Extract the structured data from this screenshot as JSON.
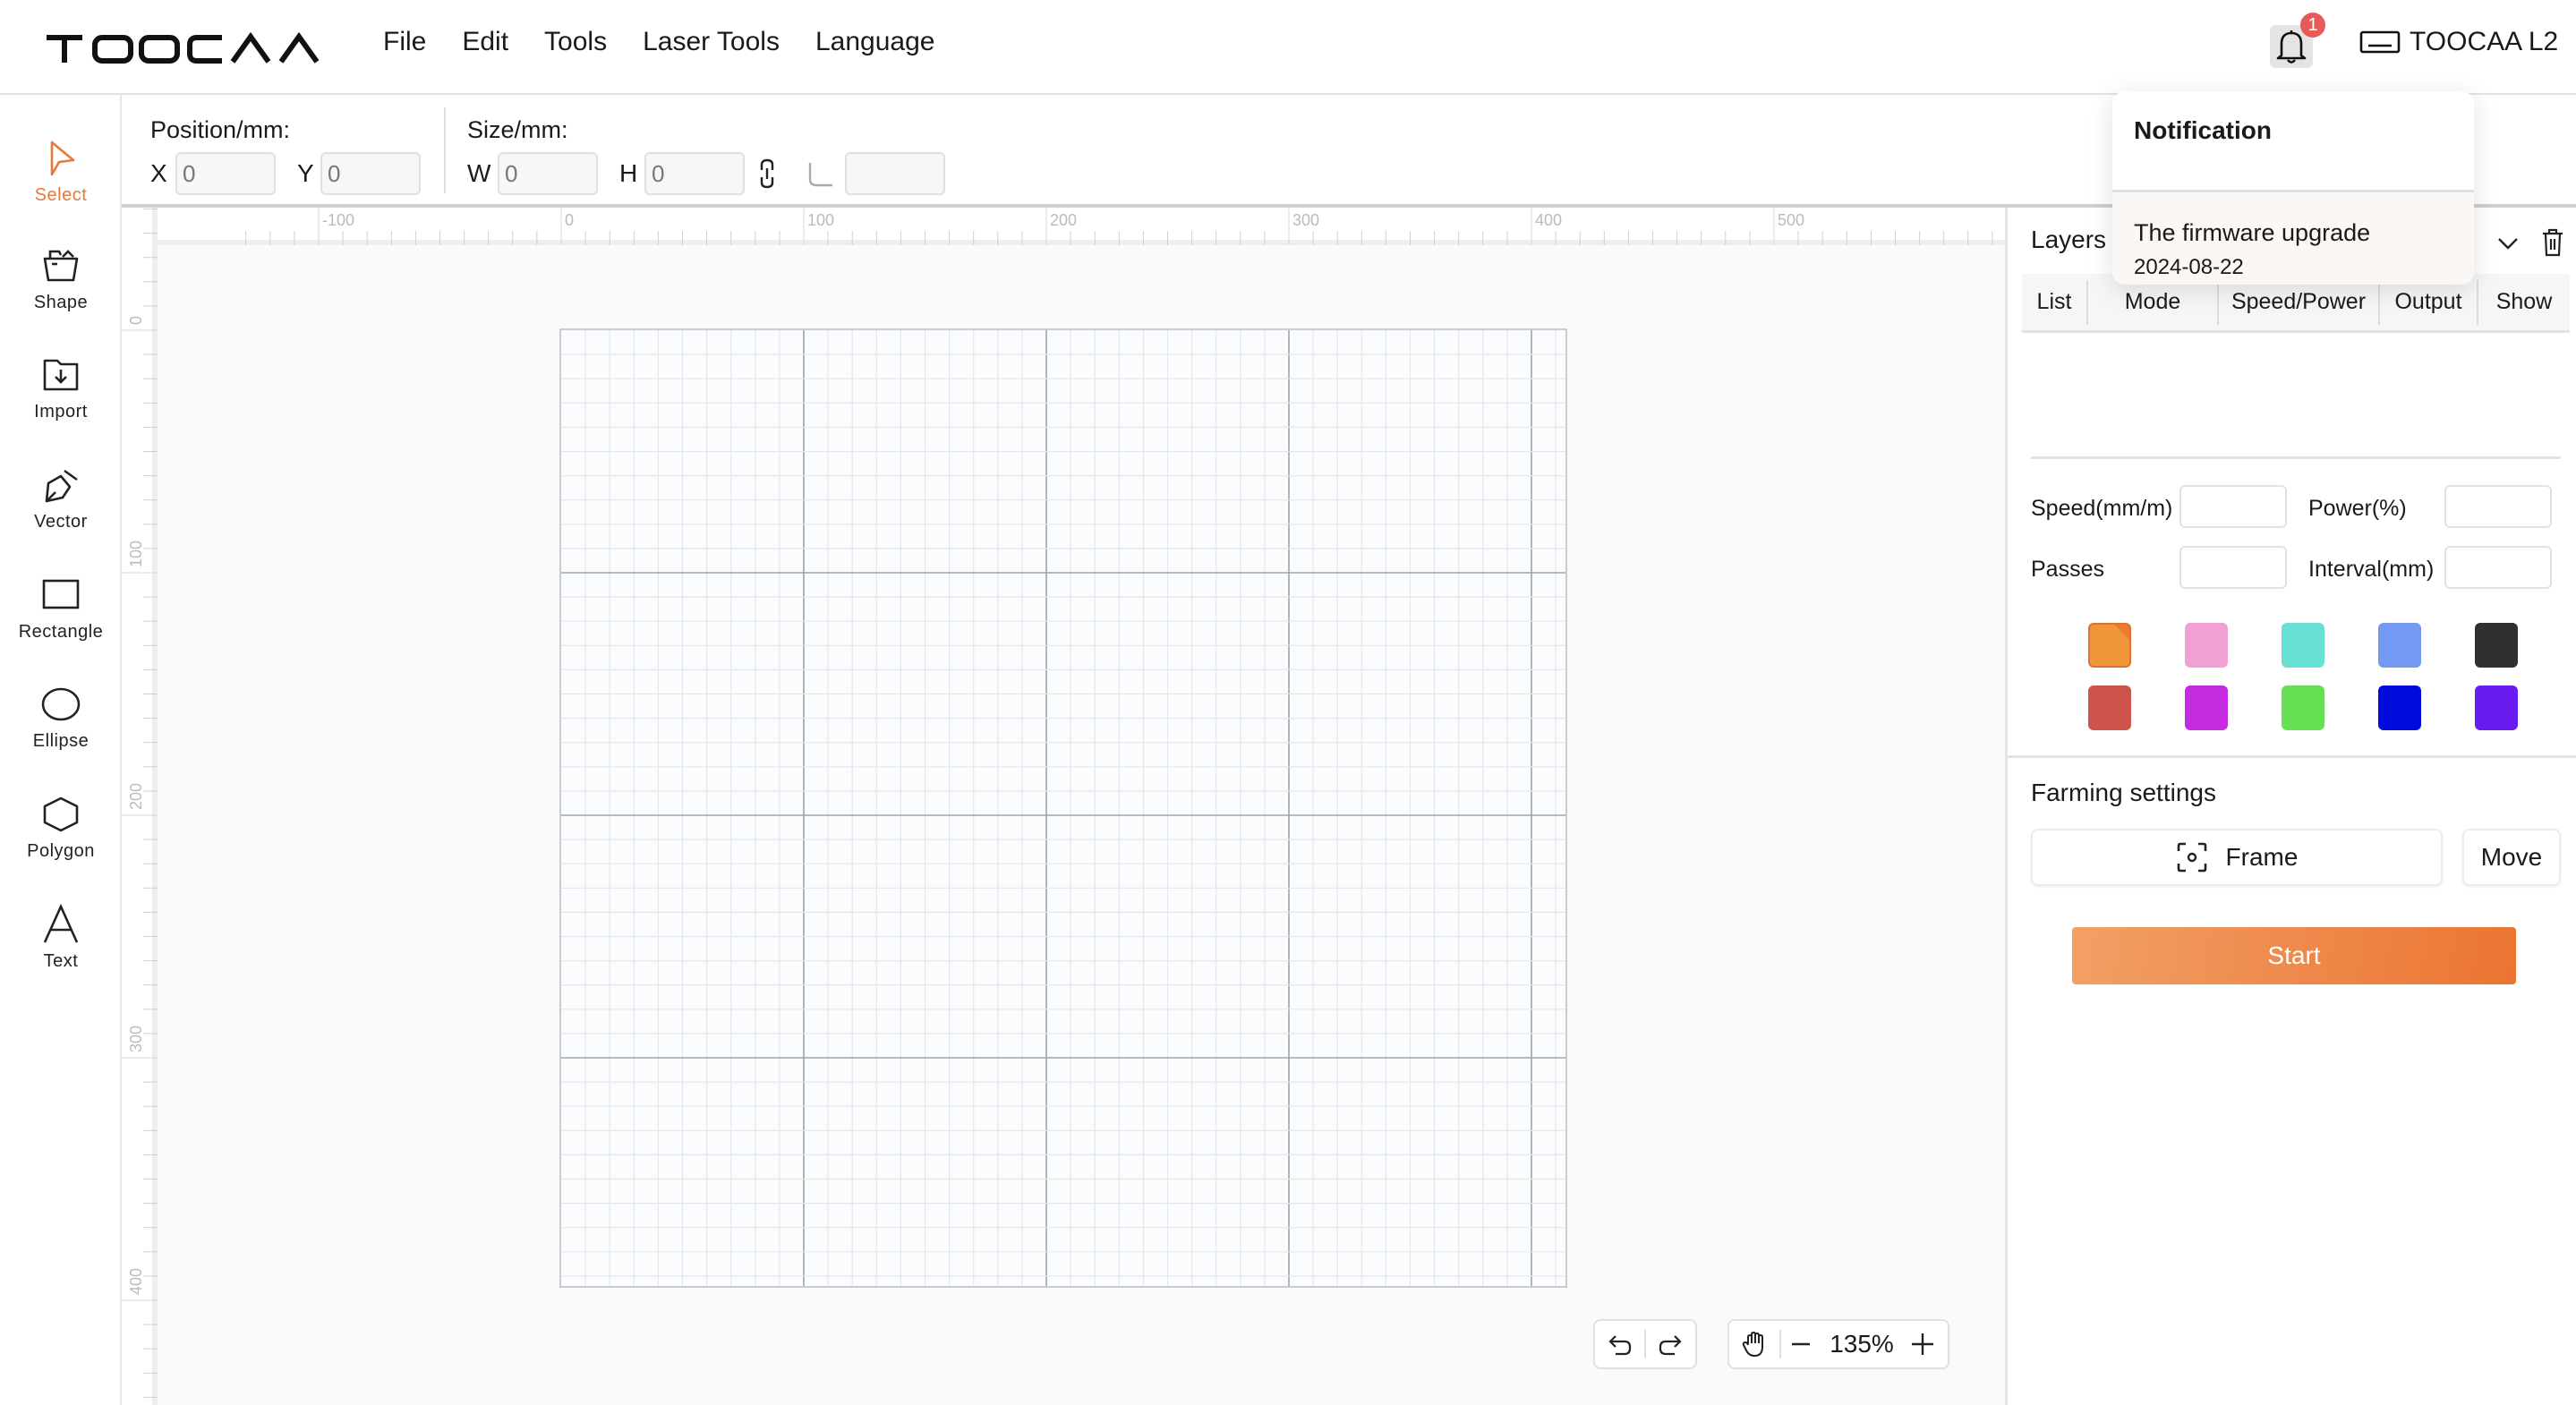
{
  "app": {
    "logo_text": "TOOCAA",
    "menu": [
      "File",
      "Edit",
      "Tools",
      "Laser Tools",
      "Language"
    ],
    "notification_count": "1",
    "device_name": "TOOCAA L2",
    "accent_color": "#e57a3a"
  },
  "tools": [
    {
      "label": "Select",
      "icon": "cursor-icon",
      "active": true
    },
    {
      "label": "Shape",
      "icon": "shape-box-icon",
      "active": false
    },
    {
      "label": "Import",
      "icon": "import-folder-icon",
      "active": false
    },
    {
      "label": "Vector",
      "icon": "pen-icon",
      "active": false
    },
    {
      "label": "Rectangle",
      "icon": "rectangle-icon",
      "active": false
    },
    {
      "label": "Ellipse",
      "icon": "ellipse-icon",
      "active": false
    },
    {
      "label": "Polygon",
      "icon": "hexagon-icon",
      "active": false
    },
    {
      "label": "Text",
      "icon": "text-icon",
      "active": false
    }
  ],
  "properties": {
    "position_label": "Position/mm:",
    "size_label": "Size/mm:",
    "x_label": "X",
    "x_value": "0",
    "y_label": "Y",
    "y_value": "0",
    "w_label": "W",
    "w_value": "0",
    "h_label": "H",
    "h_value": "0",
    "corner_value": ""
  },
  "canvas": {
    "ruler_top_labels": [
      "-100",
      "0",
      "100",
      "200",
      "300",
      "400",
      "500"
    ],
    "ruler_left_labels": [
      "0",
      "100",
      "200",
      "300",
      "400"
    ],
    "zoom_level": "135%"
  },
  "notification": {
    "title": "Notification",
    "items": [
      {
        "message": "The firmware upgrade",
        "date": "2024-08-22"
      }
    ]
  },
  "layers": {
    "title": "Layers",
    "columns": [
      "List",
      "Mode",
      "Speed/Power",
      "Output",
      "Show"
    ],
    "speed_label": "Speed(mm/m)",
    "power_label": "Power(%)",
    "passes_label": "Passes",
    "interval_label": "Interval(mm)",
    "speed_value": "",
    "power_value": "",
    "passes_value": "",
    "interval_value": "",
    "colors": [
      "#f0963a",
      "#f0a0d4",
      "#68e0d4",
      "#7399f3",
      "#303030",
      "#cd534c",
      "#c42ae0",
      "#66e052",
      "#000cdc",
      "#6a1cf0"
    ],
    "selected_color_index": 0
  },
  "framing": {
    "title": "Farming settings",
    "frame_label": "Frame",
    "move_label": "Move",
    "start_label": "Start"
  }
}
